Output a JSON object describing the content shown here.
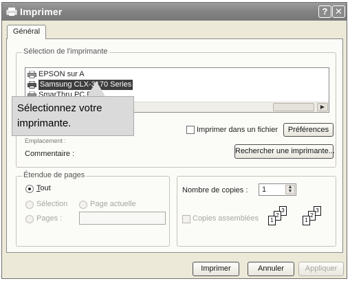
{
  "window": {
    "title": "Imprimer",
    "help": "?",
    "close": "✕"
  },
  "tabs": [
    {
      "label": "Général"
    }
  ],
  "printer_selection": {
    "legend": "Sélection de l'imprimante",
    "printers": [
      {
        "label": "EPSON sur A",
        "selected": false
      },
      {
        "label": "Samsung CLX-3170 Series",
        "selected": true
      },
      {
        "label": "SmarThru PC Fa",
        "selected": false
      }
    ],
    "callout": "Sélectionnez votre\nimprimante.",
    "location_label": "Emplacement :",
    "comment_label": "Commentaire :",
    "print_to_file_label": "Imprimer dans un fichier",
    "preferences_button": "Préférences",
    "find_printer_button": "Rechercher une imprimante..."
  },
  "page_range": {
    "legend": "Étendue de pages",
    "all_prefix": "",
    "all_underlined": "T",
    "all_rest": "out",
    "selection_label": "Sélection",
    "current_page_label": "Page actuelle",
    "pages_label": "Pages :"
  },
  "copies": {
    "count_label": "Nombre de copies :",
    "count_value": "1",
    "collate_label": "Copies assemblées"
  },
  "footer": {
    "print_button": "Imprimer",
    "cancel_button": "Annuler",
    "apply_button": "Appliquer"
  }
}
